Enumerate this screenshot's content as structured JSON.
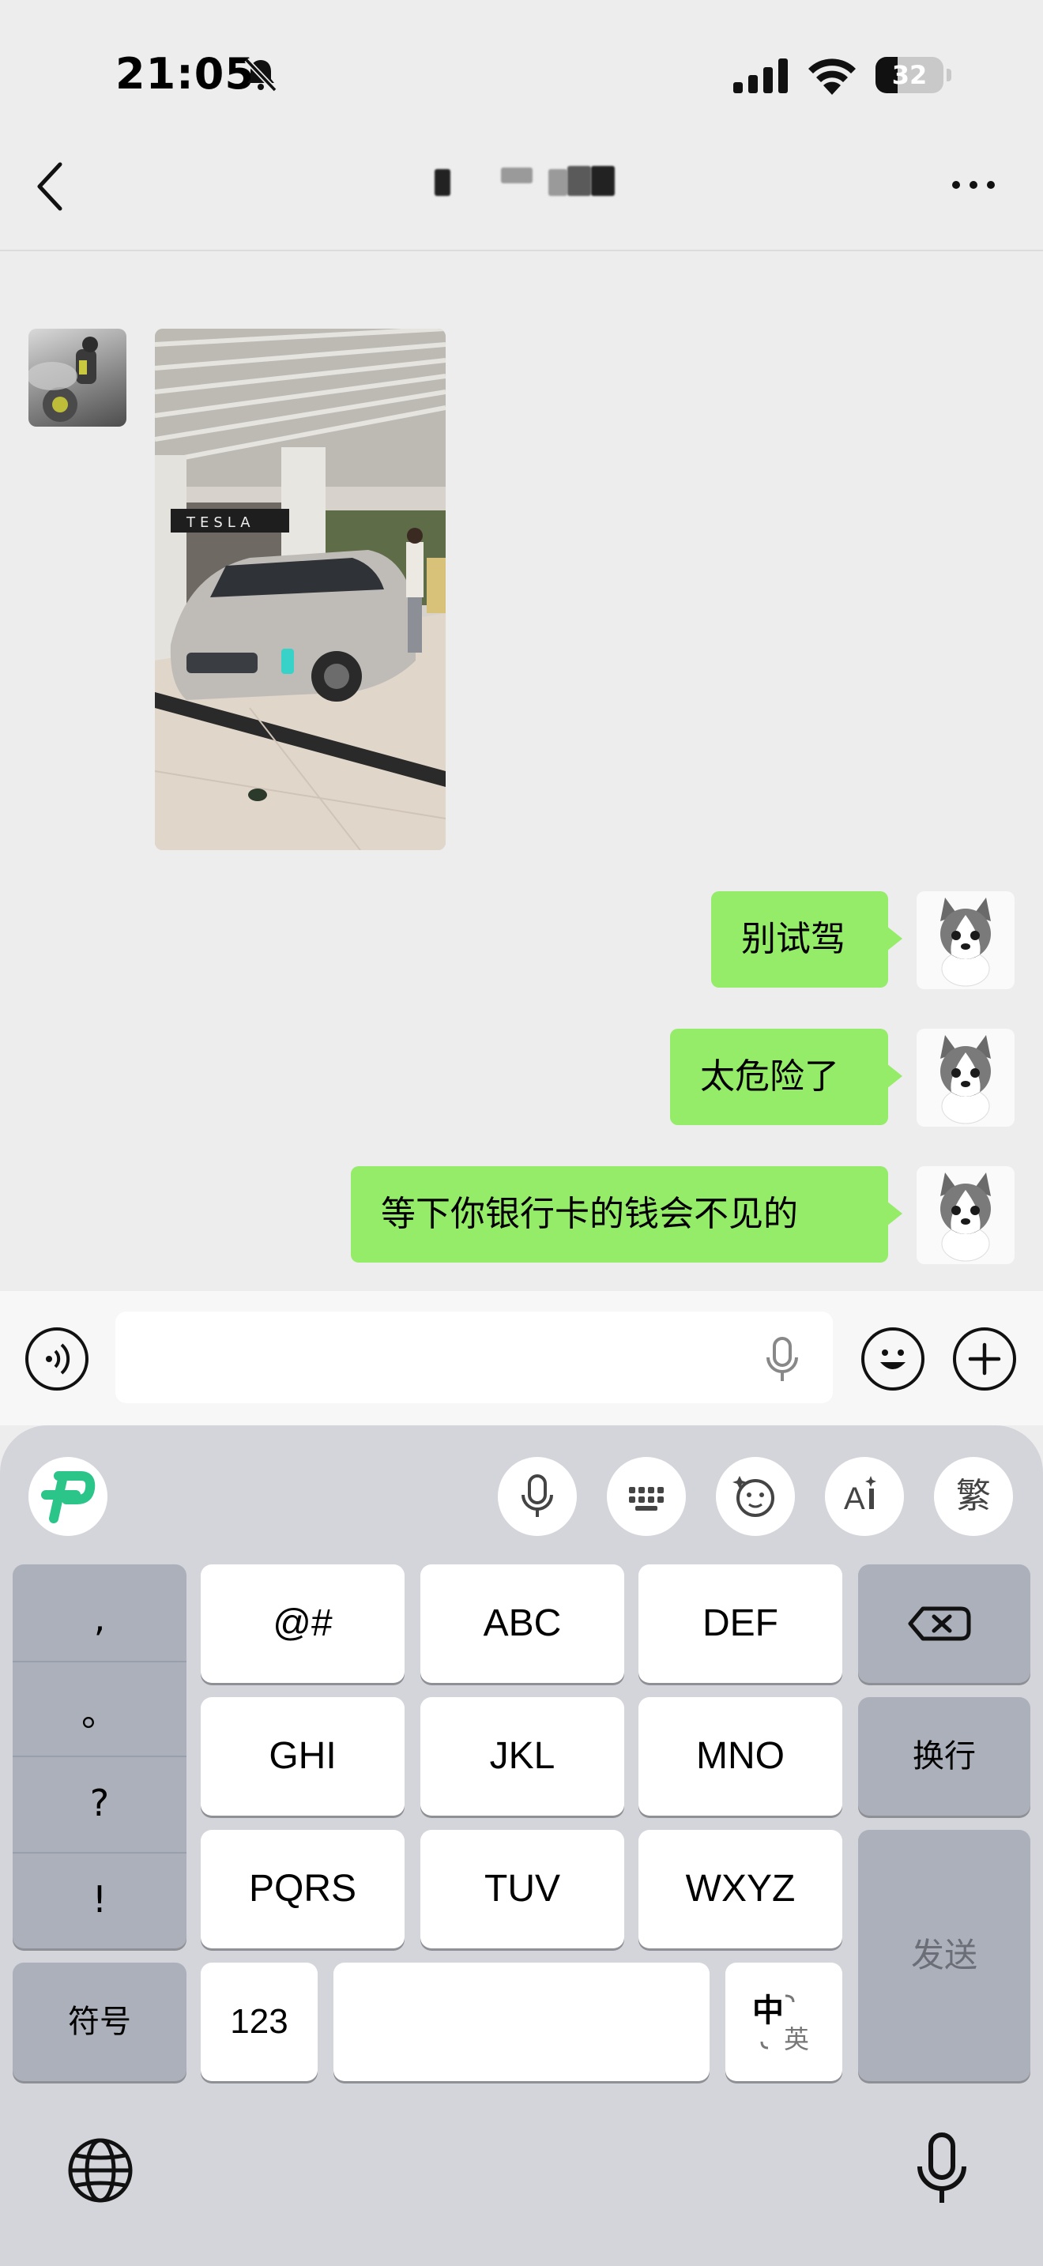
{
  "status_bar": {
    "time": "21:05",
    "battery": 32,
    "battery_level": 0.32
  },
  "header": {
    "title_redacted": true
  },
  "messages": [
    {
      "type": "image",
      "direction": "incoming"
    },
    {
      "type": "text",
      "direction": "outgoing",
      "text": "别试驾"
    },
    {
      "type": "text",
      "direction": "outgoing",
      "text": "太危险了"
    },
    {
      "type": "text",
      "direction": "outgoing",
      "text": "等下你银行卡的钱会不见的"
    }
  ],
  "photo": {
    "signage": "TESLA"
  },
  "input": {
    "value": ""
  },
  "keyboard": {
    "toolbar": {
      "trad_label": "繁"
    },
    "punct": [
      ",",
      "。",
      "?",
      "!"
    ],
    "rows": [
      [
        "@#",
        "ABC",
        "DEF"
      ],
      [
        "GHI",
        "JKL",
        "MNO"
      ],
      [
        "PQRS",
        "TUV",
        "WXYZ"
      ]
    ],
    "symbols_label": "符号",
    "num_label": "123",
    "newline_label": "换行",
    "send_label": "发送",
    "lang_main": "中",
    "lang_sub": "英"
  },
  "colors": {
    "bubble": "#95ec69",
    "background": "#ededed",
    "keyboard": "#d4d5da",
    "logo": "#2bc489"
  },
  "icons": [
    "bell-slash-icon",
    "signal-icon",
    "wifi-icon",
    "battery-icon",
    "back-icon",
    "more-icon",
    "voice-icon",
    "mic-icon",
    "emoji-icon",
    "plus-icon",
    "logo-icon",
    "grid-keyboard-icon",
    "sticker-icon",
    "ai-icon",
    "backspace-icon",
    "globe-icon"
  ]
}
